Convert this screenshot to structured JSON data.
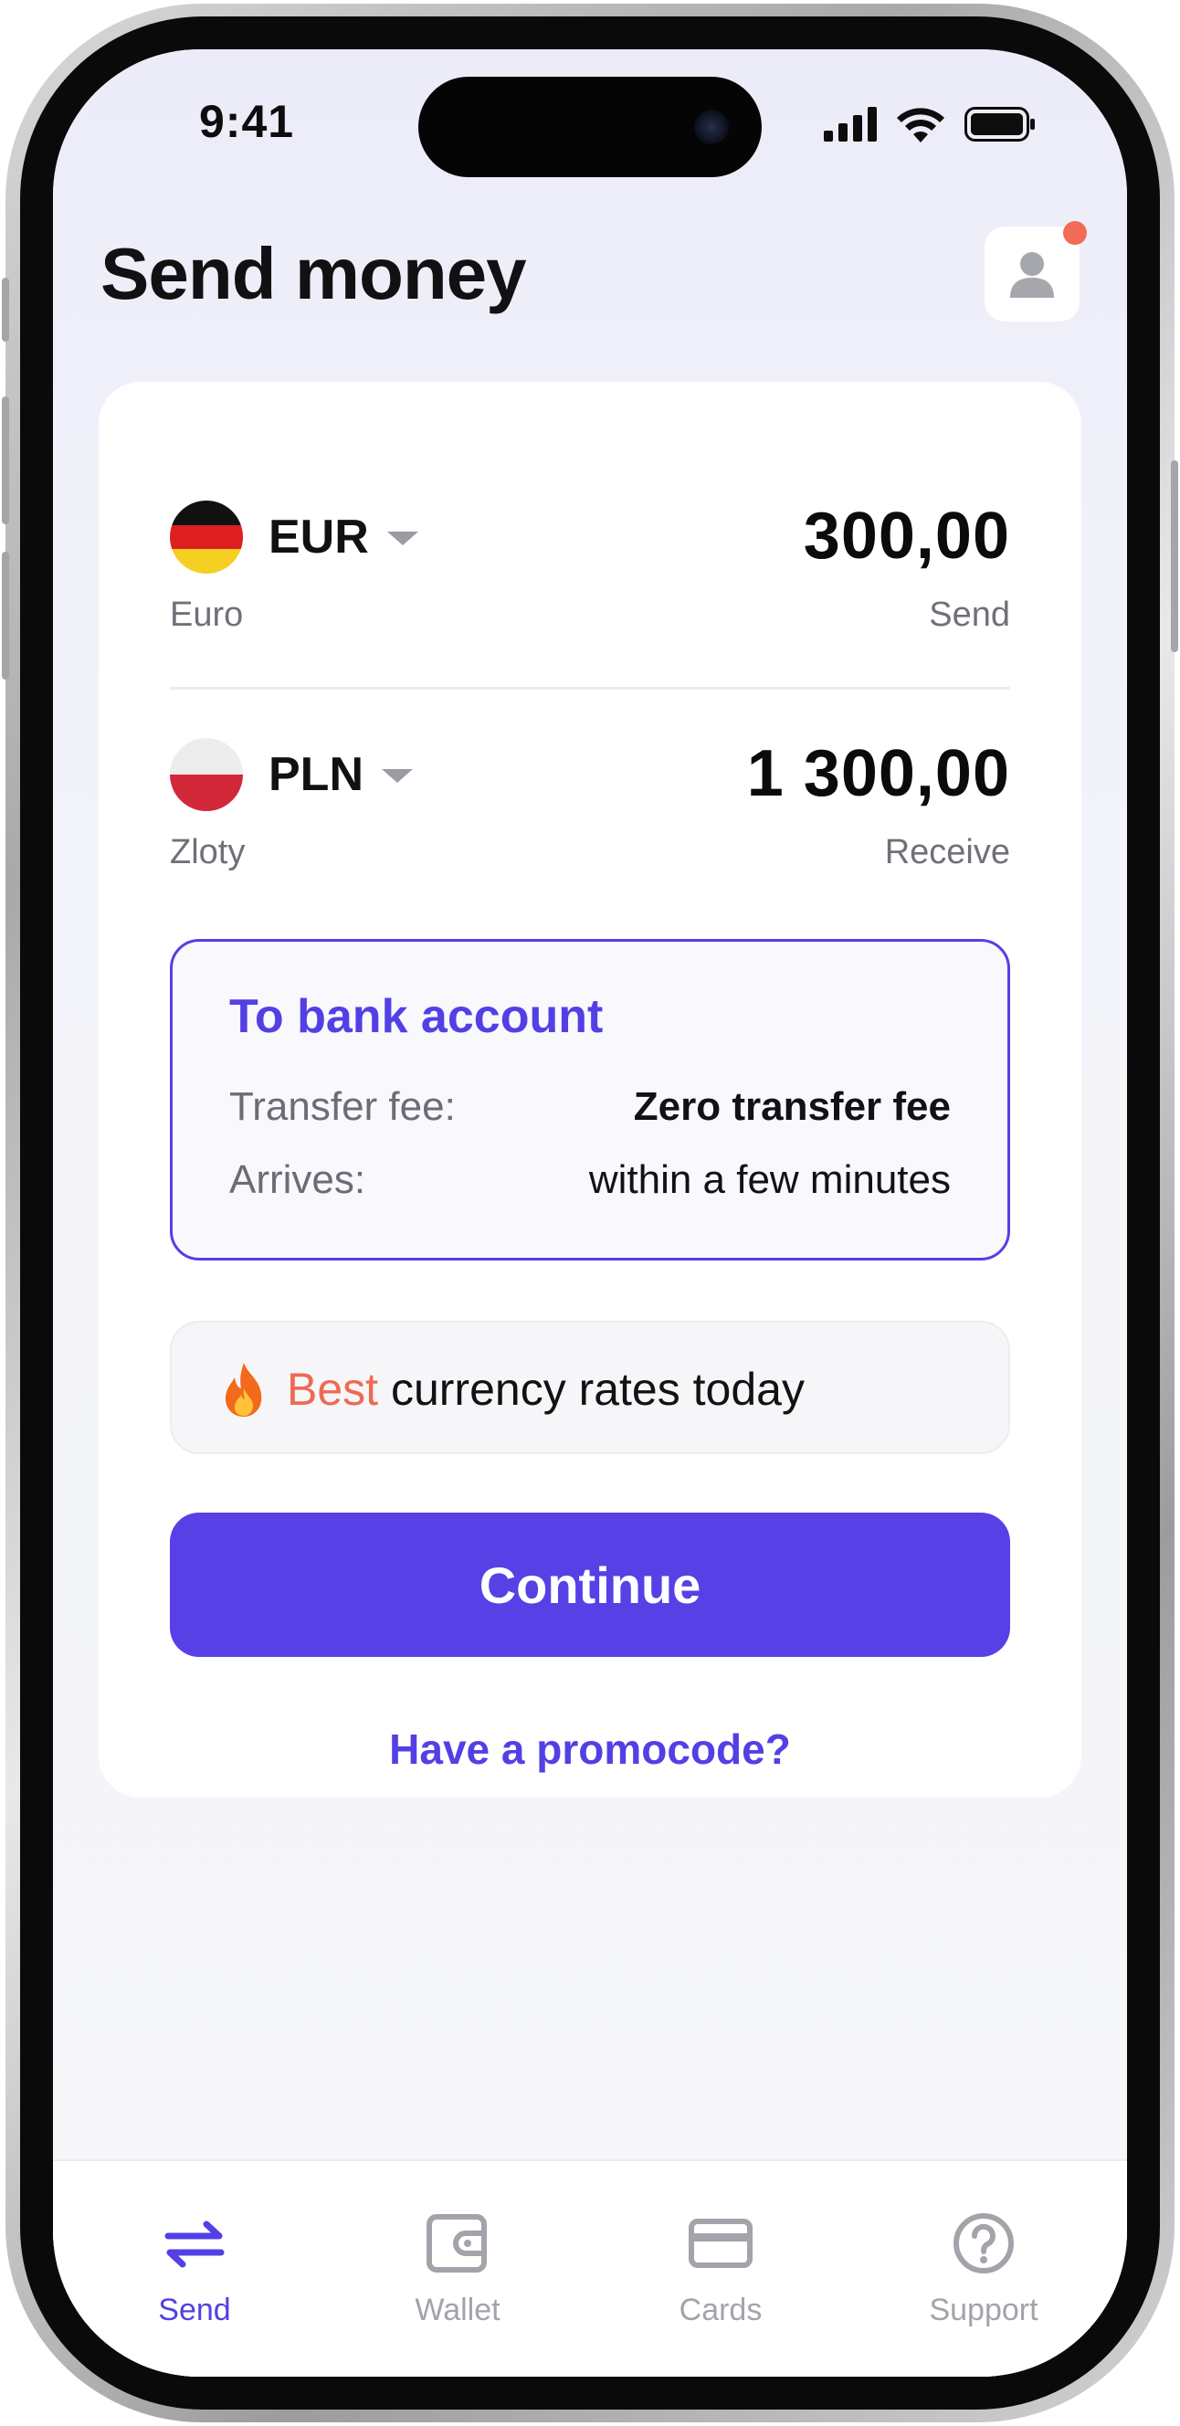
{
  "status_bar": {
    "time": "9:41"
  },
  "header": {
    "title": "Send money"
  },
  "send": {
    "currency_code": "EUR",
    "currency_name": "Euro",
    "amount": "300,00",
    "caption": "Send"
  },
  "receive": {
    "currency_code": "PLN",
    "currency_name": "Zloty",
    "amount": "1 300,00",
    "caption": "Receive"
  },
  "delivery_method": {
    "title": "To bank account",
    "fee_label": "Transfer fee:",
    "fee_value": "Zero transfer fee",
    "arrival_label": "Arrives:",
    "arrival_value": "within a few minutes"
  },
  "rates_banner": {
    "icon": "fire-icon",
    "highlight": "Best",
    "text": "currency rates today"
  },
  "actions": {
    "continue_label": "Continue",
    "promo_label": "Have a promocode?"
  },
  "tabbar": {
    "tabs": [
      {
        "label": "Send",
        "icon": "transfer-arrows-icon",
        "active": true
      },
      {
        "label": "Wallet",
        "icon": "wallet-icon",
        "active": false
      },
      {
        "label": "Cards",
        "icon": "card-icon",
        "active": false
      },
      {
        "label": "Support",
        "icon": "question-circle-icon",
        "active": false
      }
    ]
  },
  "colors": {
    "accent": "#5340e4",
    "button": "#5640e6",
    "highlight": "#ee6a52",
    "notification_dot": "#f26b57"
  }
}
